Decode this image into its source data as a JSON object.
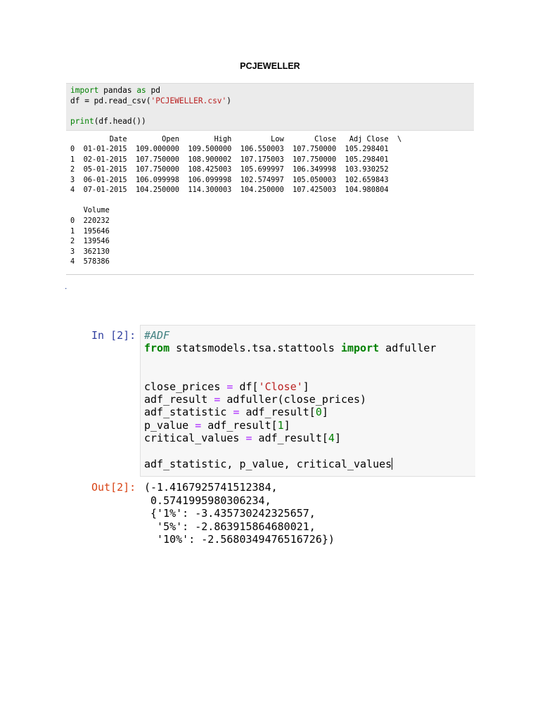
{
  "doc": {
    "title": "PCJEWELLER"
  },
  "snippet1": {
    "code": {
      "l1_kw_import": "import",
      "l1_mid": " pandas ",
      "l1_kw_as": "as",
      "l1_end": " pd",
      "l2_start": "df = pd.read_csv(",
      "l2_str": "'PCJEWELLER.csv'",
      "l2_end": ")",
      "l3_kw_print": "print",
      "l3_end": "(df.head())"
    },
    "output": {
      "header": "         Date        Open        High         Low       Close   Adj Close  \\",
      "rows": [
        "0  01-01-2015  109.000000  109.500000  106.550003  107.750000  105.298401",
        "1  02-01-2015  107.750000  108.900002  107.175003  107.750000  105.298401",
        "2  05-01-2015  107.750000  108.425003  105.699997  106.349998  103.930252",
        "3  06-01-2015  106.099998  106.099998  102.574997  105.050003  102.659843",
        "4  07-01-2015  104.250000  114.300003  104.250000  107.425003  104.980804"
      ],
      "volume_header": "   Volume",
      "volume_rows": [
        "0  220232",
        "1  195646",
        "2  139546",
        "3  362130",
        "4  578386"
      ]
    },
    "stray_dot": "."
  },
  "snippet2": {
    "in_prompt": "In [2]:",
    "out_prompt": "Out[2]:",
    "code": {
      "comment": "#ADF",
      "l2_kw_from": "from",
      "l2_mid": " statsmodels.tsa.stattools ",
      "l2_kw_import": "import",
      "l2_end": " adfuller",
      "l3_a": "close_prices ",
      "l3_eq": "=",
      "l3_b": " df[",
      "l3_str": "'Close'",
      "l3_c": "]",
      "l4_a": "adf_result ",
      "l4_eq": "=",
      "l4_b": " adfuller(close_prices)",
      "l5_a": "adf_statistic ",
      "l5_eq": "=",
      "l5_b": " adf_result[",
      "l5_num": "0",
      "l5_c": "]",
      "l6_a": "p_value ",
      "l6_eq": "=",
      "l6_b": " adf_result[",
      "l6_num": "1",
      "l6_c": "]",
      "l7_a": "critical_values ",
      "l7_eq": "=",
      "l7_b": " adf_result[",
      "l7_num": "4",
      "l7_c": "]",
      "l8": "adf_statistic, p_value, critical_values"
    },
    "output": [
      "(-1.4167925741512384,",
      " 0.5741995980306234,",
      " {'1%': -3.435730242325657,",
      "  '5%': -2.863915864680021,",
      "  '10%': -2.5680349476516726})"
    ]
  }
}
